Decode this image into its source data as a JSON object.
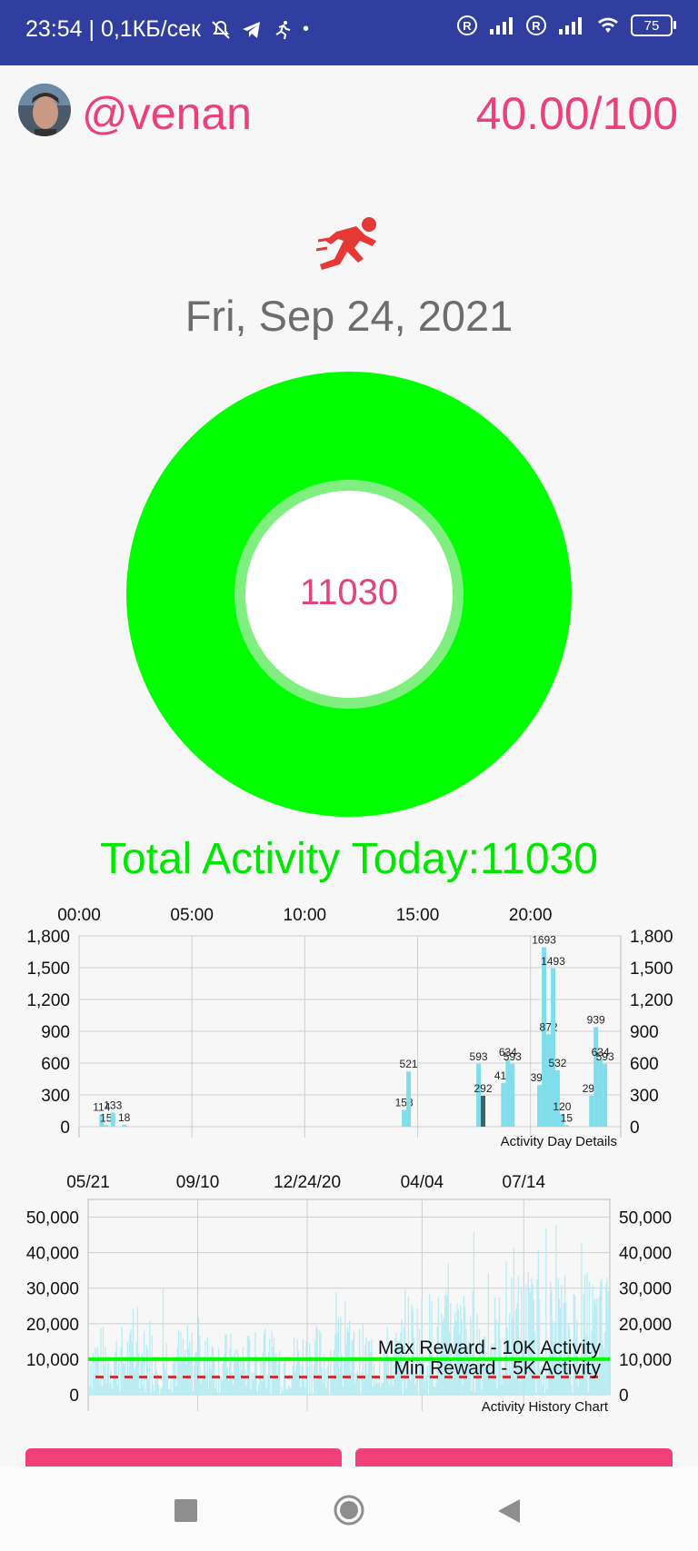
{
  "status_bar": {
    "time_speed": "23:54 | 0,1КБ/сек",
    "battery": "75",
    "icons": [
      "mute-icon",
      "telegram-icon",
      "runner-small-icon",
      "dot-icon",
      "roaming-r-icon",
      "signal-icon",
      "roaming-r-icon",
      "signal-icon",
      "wifi-icon",
      "battery-icon"
    ]
  },
  "header": {
    "username": "@venan",
    "score": "40.00/100"
  },
  "date": "Fri, Sep 24, 2021",
  "donut": {
    "value": "11030",
    "progress_fraction": 1.0,
    "color": "#00ff00"
  },
  "total_activity": "Total Activity Today:11030",
  "colors": {
    "accent": "#ec407a",
    "green": "#00ff00",
    "bar": "#80deea",
    "bar_dark": "#37676d",
    "status_bar": "#303f9f"
  },
  "charts": {
    "day": {
      "x_ticks": [
        "00:00",
        "05:00",
        "10:00",
        "15:00",
        "20:00"
      ],
      "y_ticks": [
        "1,800",
        "1,500",
        "1,200",
        "900",
        "600",
        "300",
        "0"
      ],
      "description": "Activity Day Details"
    },
    "history": {
      "x_ticks": [
        "05/21",
        "09/10",
        "12/24/20",
        "04/04",
        "07/14"
      ],
      "y_ticks": [
        "50,000",
        "40,000",
        "30,000",
        "20,000",
        "10,000",
        "0"
      ],
      "description": "Activity History Chart",
      "max_line_label": "Max Reward - 10K Activity",
      "min_line_label": "Min Reward - 5K Activity"
    }
  },
  "chart_data": [
    {
      "type": "bar",
      "title": "",
      "description": "Activity Day Details",
      "x_unit": "hour",
      "xlim": [
        0,
        24
      ],
      "ylim": [
        0,
        1800
      ],
      "x_ticks": [
        "00:00",
        "05:00",
        "10:00",
        "15:00",
        "20:00"
      ],
      "bars": [
        {
          "x": 1.0,
          "y": 114,
          "label": "114"
        },
        {
          "x": 1.2,
          "y": 15,
          "label": "15"
        },
        {
          "x": 1.5,
          "y": 133,
          "label": "133"
        },
        {
          "x": 2.0,
          "y": 18,
          "label": "18"
        },
        {
          "x": 14.4,
          "y": 158,
          "label": "158"
        },
        {
          "x": 14.6,
          "y": 521,
          "label": "521"
        },
        {
          "x": 17.7,
          "y": 593,
          "label": "593"
        },
        {
          "x": 17.9,
          "y": 292,
          "label": "292",
          "dark": true
        },
        {
          "x": 18.8,
          "y": 413,
          "label": "413"
        },
        {
          "x": 19.0,
          "y": 634,
          "label": "634"
        },
        {
          "x": 19.2,
          "y": 593,
          "label": "593"
        },
        {
          "x": 20.4,
          "y": 393,
          "label": "393"
        },
        {
          "x": 20.6,
          "y": 1693,
          "label": "1693"
        },
        {
          "x": 20.8,
          "y": 872,
          "label": "872"
        },
        {
          "x": 21.0,
          "y": 1493,
          "label": "1493"
        },
        {
          "x": 21.2,
          "y": 532,
          "label": "532"
        },
        {
          "x": 21.4,
          "y": 120,
          "label": "120"
        },
        {
          "x": 21.6,
          "y": 15,
          "label": "15"
        },
        {
          "x": 22.7,
          "y": 292,
          "label": "292"
        },
        {
          "x": 22.9,
          "y": 939,
          "label": "939"
        },
        {
          "x": 23.1,
          "y": 634,
          "label": "634"
        },
        {
          "x": 23.3,
          "y": 593,
          "label": "593"
        }
      ]
    },
    {
      "type": "bar",
      "title": "",
      "description": "Activity History Chart",
      "ylim": [
        0,
        55000
      ],
      "x_ticks": [
        "05/21",
        "09/10",
        "12/24/20",
        "04/04",
        "07/14"
      ],
      "reference_lines": [
        {
          "label": "Max Reward - 10K Activity",
          "y": 10000,
          "style": "solid",
          "color": "#00ff00"
        },
        {
          "label": "Min Reward - 5K Activity",
          "y": 5000,
          "style": "dashed",
          "color": "#d32f2f"
        }
      ],
      "series_envelope": [
        {
          "segment": "05/21-09/10",
          "typical_max": 20000,
          "peak": 33000
        },
        {
          "segment": "09/10-12/24/20",
          "typical_max": 18000,
          "peak": 22000
        },
        {
          "segment": "12/24/20-04/04",
          "typical_max": 20000,
          "peak": 32000
        },
        {
          "segment": "04/04-07/14",
          "typical_max": 30000,
          "peak": 50000
        },
        {
          "segment": "07/14-end",
          "typical_max": 35000,
          "peak": 49000
        }
      ]
    }
  ],
  "navbar": {
    "icons": [
      "recent-apps-icon",
      "home-icon",
      "back-icon"
    ]
  }
}
